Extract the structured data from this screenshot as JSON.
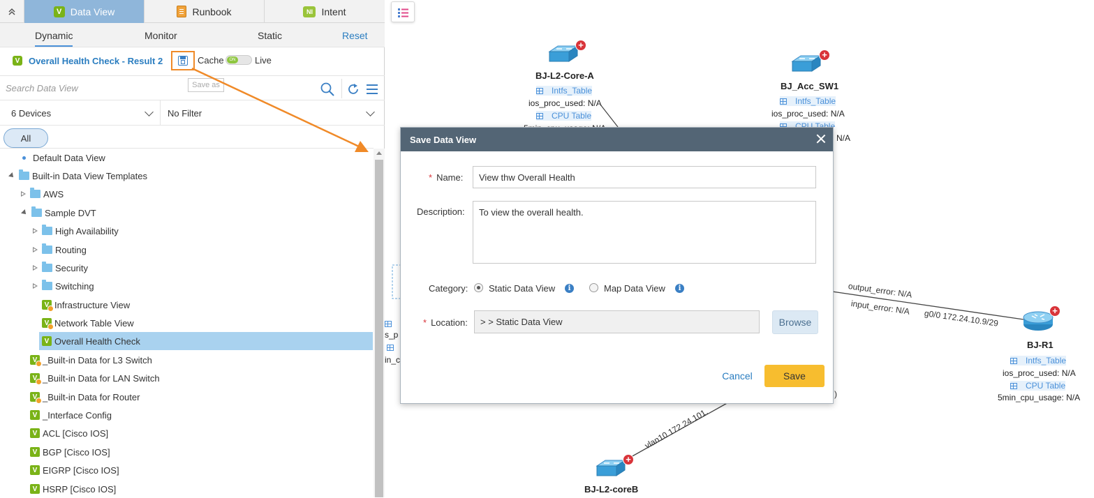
{
  "top_tabs": [
    {
      "label": "Data View",
      "icon": "data-view-icon",
      "active": true
    },
    {
      "label": "Runbook",
      "icon": "runbook-icon"
    },
    {
      "label": "Intent",
      "icon": "intent-icon",
      "badge": "NI"
    }
  ],
  "sub_tabs": {
    "dynamic": "Dynamic",
    "monitor": "Monitor",
    "static": "Static",
    "reset": "Reset"
  },
  "view_header": {
    "badge": "V",
    "title": "Overall Health Check - Result 2",
    "cache_label": "Cache",
    "live_label": "Live",
    "toggle_knob": "ON",
    "tooltip": "Save as"
  },
  "search": {
    "placeholder": "Search Data View"
  },
  "filters": {
    "devices": "6 Devices",
    "filter": "No Filter"
  },
  "all_chip": "All",
  "tree": [
    {
      "label": "Default Data View",
      "type": "dot"
    },
    {
      "label": "Built-in Data View Templates",
      "type": "folder-open"
    },
    {
      "label": "AWS",
      "type": "folder-closed"
    },
    {
      "label": "Sample DVT",
      "type": "folder-open"
    },
    {
      "label": "High Availability",
      "type": "folder-closed"
    },
    {
      "label": "Routing",
      "type": "folder-closed"
    },
    {
      "label": "Security",
      "type": "folder-closed"
    },
    {
      "label": "Switching",
      "type": "folder-closed"
    },
    {
      "label": "Infrastructure View",
      "type": "dv-warn"
    },
    {
      "label": "Network Table View",
      "type": "dv-warn"
    },
    {
      "label": "Overall Health Check",
      "type": "dv",
      "selected": true
    },
    {
      "label": "_Built-in Data for L3 Switch",
      "type": "dv-warn"
    },
    {
      "label": "_Built-in Data for LAN Switch",
      "type": "dv-warn"
    },
    {
      "label": "_Built-in Data for Router",
      "type": "dv-warn"
    },
    {
      "label": "_Interface Config",
      "type": "dv"
    },
    {
      "label": "ACL [Cisco IOS]",
      "type": "dv"
    },
    {
      "label": "BGP [Cisco IOS]",
      "type": "dv"
    },
    {
      "label": "EIGRP [Cisco IOS]",
      "type": "dv"
    },
    {
      "label": "HSRP [Cisco IOS]",
      "type": "dv"
    }
  ],
  "map": {
    "devices": [
      {
        "name": "BJ-L2-Core-A",
        "table1": "Intfs_Table",
        "metric1": "ios_proc_used: N/A",
        "table2": "CPU Table",
        "metric2": "5min_cpu_usage: N/A"
      },
      {
        "name": "BJ_Acc_SW1",
        "table1": "Intfs_Table",
        "metric1": "ios_proc_used: N/A",
        "table2": "CPU Table",
        "metric2": "N/A"
      },
      {
        "name": "BJ-R1",
        "table1": "Intfs_Table",
        "metric1": "ios_proc_used: N/A",
        "table2": "CPU Table",
        "metric2": "5min_cpu_usage: N/A"
      },
      {
        "name": "BJ-L2-coreB"
      }
    ],
    "partial_left": {
      "line1": "s_p",
      "line2": "in_c"
    },
    "edge_labels": {
      "output_error": "output_error: N/A",
      "input_error": "input_error: N/A",
      "r1_interface": "g0/0 172.24.10.9/29",
      "coreb_interface": "vlan10 172.24.101.",
      "paren": ")"
    }
  },
  "dialog": {
    "title": "Save Data View",
    "name_label": "Name:",
    "name_value": "View thw Overall Health",
    "description_label": "Description:",
    "description_value": "To view the overall health.",
    "category_label": "Category:",
    "category_static": "Static Data View",
    "category_map": "Map Data View",
    "category_selected": "Static Data View",
    "location_label": "Location:",
    "location_value": "> > Static Data View",
    "browse_label": "Browse",
    "cancel_label": "Cancel",
    "save_label": "Save",
    "required_mark": "*",
    "info_glyph": "i"
  },
  "colors": {
    "active_tab": "#8fb6da",
    "link_blue": "#2a7dc0",
    "dialog_header": "#536575",
    "save_button": "#f7bd2f",
    "highlight_orange": "#f08a28",
    "selected_row": "#a9d2ef",
    "device_badge_red": "#d9343a"
  }
}
